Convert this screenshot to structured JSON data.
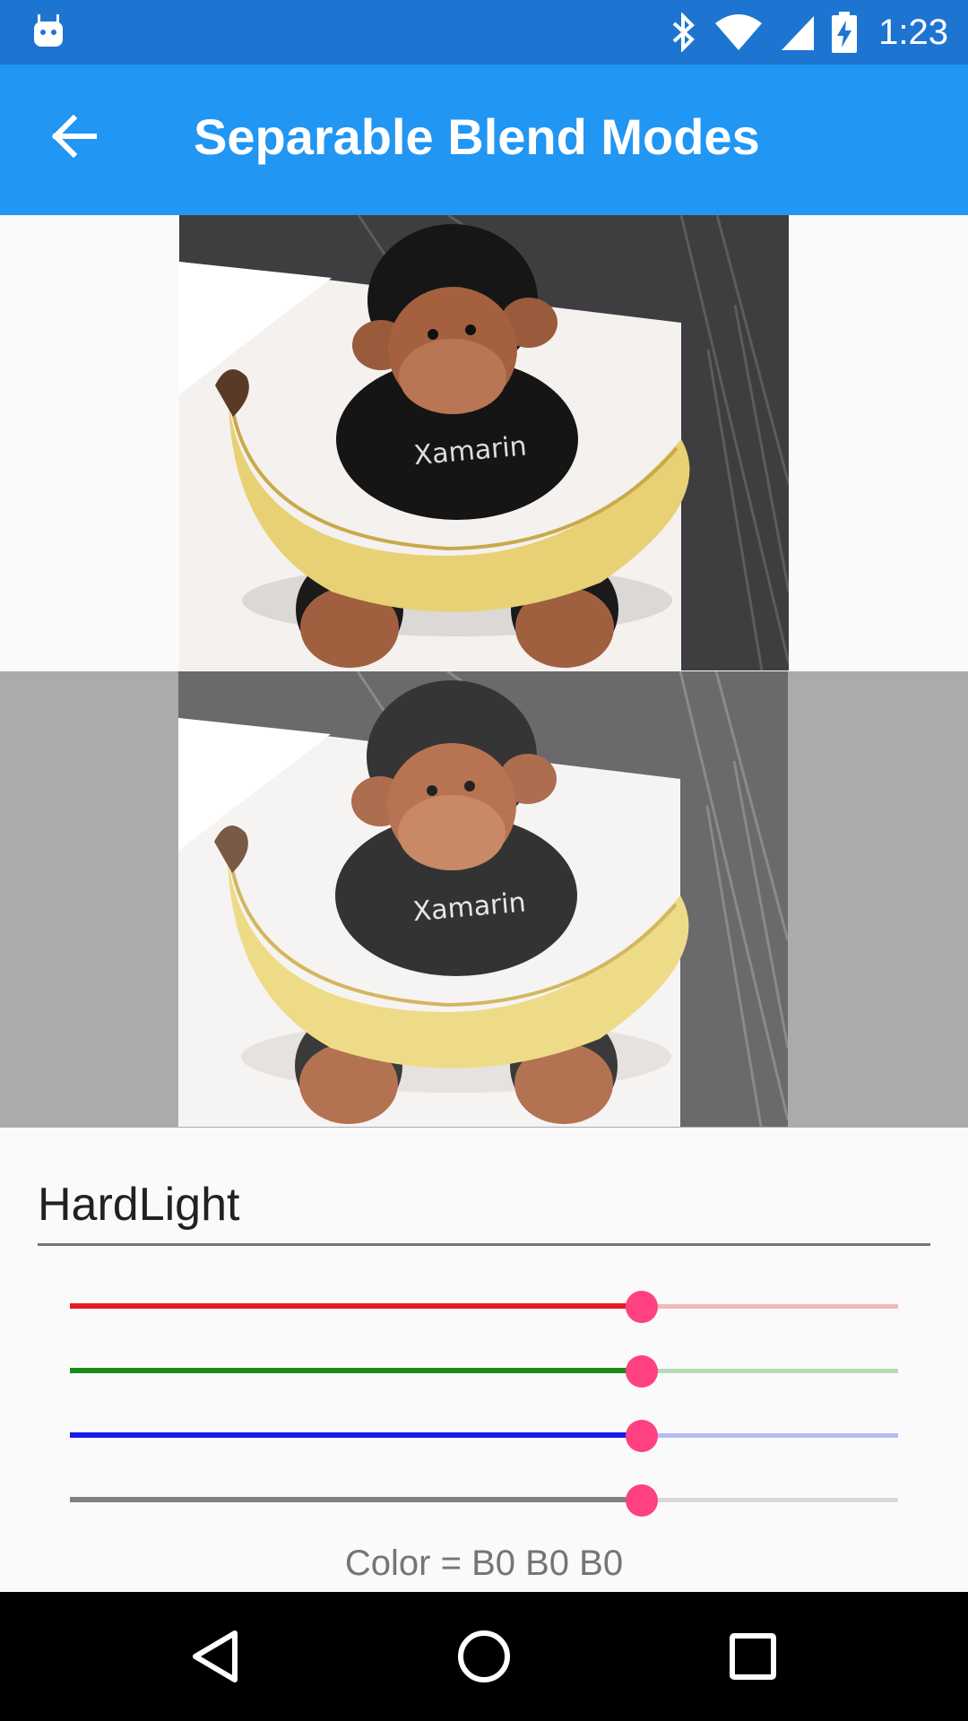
{
  "status_bar": {
    "time": "1:23",
    "icons": [
      "android-notification-icon",
      "bluetooth-icon",
      "wifi-icon",
      "cell-signal-icon",
      "battery-charging-icon"
    ]
  },
  "app_bar": {
    "title": "Separable Blend Modes",
    "back_icon": "arrow-back-icon"
  },
  "images": {
    "top_caption": "Xamarin",
    "bottom_caption": "Xamarin"
  },
  "blend_mode": {
    "selected": "HardLight"
  },
  "sliders": [
    {
      "name": "red",
      "value": 0.69,
      "color": "#e51c23",
      "track_color": "#f4b7b9"
    },
    {
      "name": "green",
      "value": 0.69,
      "color": "#1a8a1a",
      "track_color": "#b7dbb7"
    },
    {
      "name": "blue",
      "value": 0.69,
      "color": "#1a1aee",
      "track_color": "#b9b9f6"
    },
    {
      "name": "gray",
      "value": 0.69,
      "color": "#808080",
      "track_color": "#d9d9d9"
    }
  ],
  "thumb_color": "#ff4081",
  "color_readout": "Color = B0 B0 B0",
  "nav_bar": {
    "icons": [
      "back-triangle-icon",
      "home-circle-icon",
      "recents-square-icon"
    ]
  }
}
